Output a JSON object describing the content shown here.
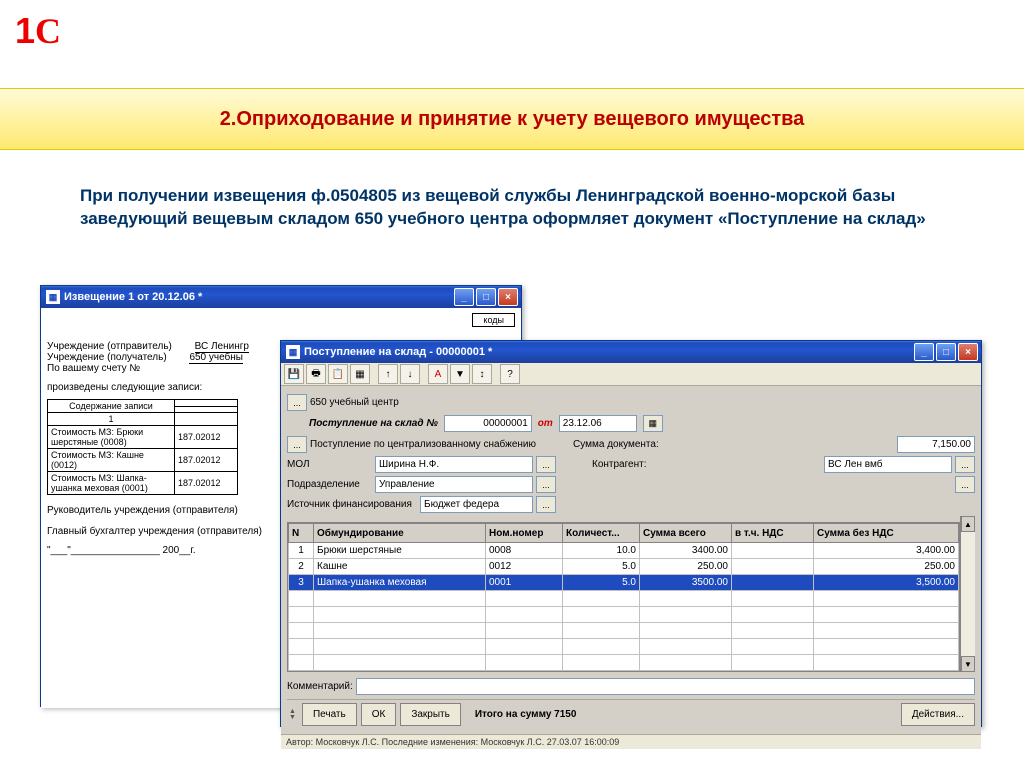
{
  "logo": "1C",
  "title": "2.Оприходование и принятие к учету вещевого имущества",
  "description": "При получении извещения ф.0504805 из вещевой службы Ленинградской военно-морской базы заведующий вещевым складом 650 учебного центра оформляет документ «Поступление на склад»",
  "win1": {
    "title": "Извещение 1 от 20.12.06  *",
    "kody": "коды",
    "rows": {
      "sender_lbl": "Учреждение (отправитель)",
      "sender_val": "ВС Ленингр",
      "recv_lbl": "Учреждение (получатель)",
      "recv_val": "650 учебны",
      "schet_lbl": "По вашему счету №",
      "zapisi_lbl": "произведены следующие записи:",
      "soderzh": "Содержание записи",
      "col1": "1",
      "r1a": "Стоимость МЗ: Брюки шерстяные (0008)",
      "r1b": "187.02012",
      "r2a": "Стоимость МЗ: Кашне (0012)",
      "r2b": "187.02012",
      "r3a": "Стоимость МЗ: Шапка-ушанка меховая (0001)",
      "r3b": "187.02012",
      "ruk_lbl": "Руководитель учреждения (отправителя)",
      "buh_lbl": "Главный бухгалтер учреждения (отправителя)",
      "date_tpl": "\"___\"________________ 200__г."
    }
  },
  "win2": {
    "title": "Поступление на склад - 00000001 *",
    "centr": "650 учебный центр",
    "hdr_lbl": "Поступление на склад №",
    "num": "00000001",
    "ot": "от",
    "date": "23.12.06",
    "post_lbl": "Поступление по централизованному снабжению",
    "sum_lbl": "Сумма документа:",
    "sum_val": "7,150.00",
    "mol_lbl": "МОЛ",
    "mol_val": "Ширина Н.Ф.",
    "kontr_lbl": "Контрагент:",
    "kontr_val": "ВС Лен вмб",
    "podr_lbl": "Подразделение",
    "podr_val": "Управление",
    "ist_lbl": "Источник финансирования",
    "ist_val": "Бюджет федера",
    "cols": {
      "n": "N",
      "obm": "Обмундирование",
      "nom": "Ном.номер",
      "kol": "Количест...",
      "sum": "Сумма всего",
      "nds": "в т.ч. НДС",
      "bez": "Сумма без НДС"
    },
    "rows": [
      {
        "n": "1",
        "name": "Брюки шерстяные",
        "nom": "0008",
        "kol": "10.0",
        "sum": "3400.00",
        "nds": "",
        "bez": "3,400.00"
      },
      {
        "n": "2",
        "name": "Кашне",
        "nom": "0012",
        "kol": "5.0",
        "sum": "250.00",
        "nds": "",
        "bez": "250.00"
      },
      {
        "n": "3",
        "name": "Шапка-ушанка меховая",
        "nom": "0001",
        "kol": "5.0",
        "sum": "3500.00",
        "nds": "",
        "bez": "3,500.00"
      }
    ],
    "komm_lbl": "Комментарий:",
    "itogo": "Итого на сумму 7150",
    "btn_print": "Печать",
    "btn_ok": "ОК",
    "btn_close": "Закрыть",
    "btn_act": "Действия...",
    "status": "Автор: Московчук Л.С. Последние изменения: Московчук Л.С. 27.03.07 16:00:09"
  }
}
